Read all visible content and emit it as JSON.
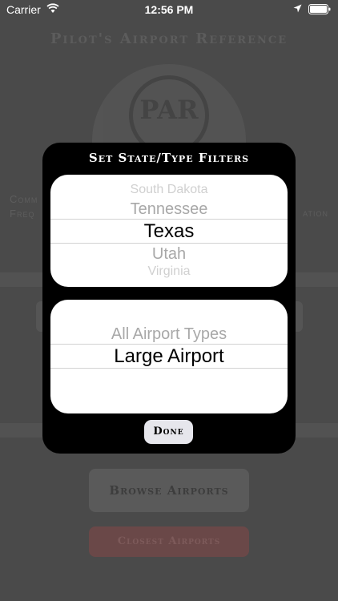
{
  "status_bar": {
    "carrier": "Carrier",
    "time": "12:56 PM"
  },
  "background": {
    "title": "Pilot's Airport Reference",
    "logo_text": "PAR",
    "left_text_1": "Comm",
    "left_text_2": "Freq",
    "right_text": "ation",
    "browse_button": "Browse Airports",
    "closest_button": "Closest Airports"
  },
  "modal": {
    "title": "Set State/Type Filters",
    "state_picker": {
      "above_2": "South Dakota",
      "above_1": "Tennessee",
      "selected": "Texas",
      "below_1": "Utah",
      "below_2": "Virginia"
    },
    "type_picker": {
      "above_1": "All Airport Types",
      "selected": "Large Airport"
    },
    "done_label": "Done"
  },
  "colors": {
    "modal_bg": "#000000",
    "picker_bg": "#ffffff",
    "dim_overlay": "#4a4a4a"
  }
}
